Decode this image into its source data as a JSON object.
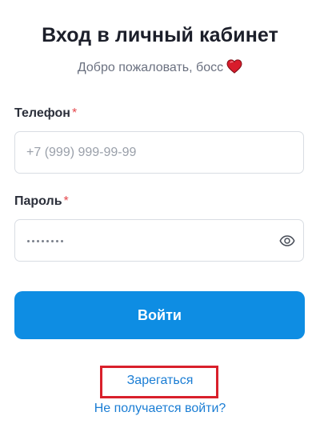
{
  "header": {
    "title": "Вход в личный кабинет",
    "subtitle": "Добро пожаловать, босс",
    "subtitle_icon": "heart-icon"
  },
  "form": {
    "phone": {
      "label": "Телефон",
      "required_mark": "*",
      "placeholder": "+7 (999) 999-99-99",
      "value": ""
    },
    "password": {
      "label": "Пароль",
      "required_mark": "*",
      "masked": true,
      "toggle_icon": "eye-icon"
    },
    "submit_label": "Войти"
  },
  "links": {
    "register": "Зарегаться",
    "help": "Не получается войти?"
  },
  "colors": {
    "accent": "#0e8de3",
    "link": "#1a7dd4",
    "required": "#e5484d",
    "highlight_box": "#d9202b",
    "heart": "#d81c2c"
  }
}
